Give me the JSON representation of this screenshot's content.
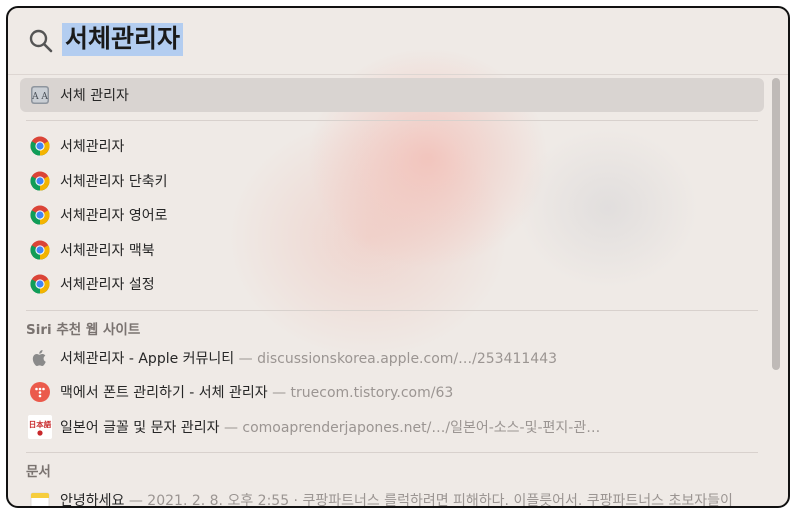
{
  "search": {
    "query": "서체관리자"
  },
  "top_hit": {
    "label": "서체 관리자",
    "icon": "font-book-icon"
  },
  "chrome_items": [
    {
      "label": "서체관리자",
      "icon": "chrome-icon"
    },
    {
      "label": "서체관리자 단축키",
      "icon": "chrome-icon"
    },
    {
      "label": "서체관리자 영어로",
      "icon": "chrome-icon"
    },
    {
      "label": "서체관리자 맥북",
      "icon": "chrome-icon"
    },
    {
      "label": "서체관리자 설정",
      "icon": "chrome-icon"
    }
  ],
  "siri_section": {
    "title": "Siri 추천 웹 사이트",
    "items": [
      {
        "label": "서체관리자 - Apple 커뮤니티",
        "source": "— discussionskorea.apple.com/…/253411443",
        "icon": "apple-logo-icon"
      },
      {
        "label": "맥에서 폰트 관리하기 - 서체 관리자",
        "source": "— truecom.tistory.com/63",
        "icon": "tistory-icon"
      },
      {
        "label": "일본어 글꼴 및 문자 관리자",
        "source": "— comoaprenderjapones.net/…/일본어-소스-및-편지-관…",
        "icon": "nihongo-site-icon",
        "badge": "日本語"
      }
    ]
  },
  "documents_section": {
    "title": "문서",
    "items": [
      {
        "label": "안녕하세요",
        "source": "— 2021. 2. 8. 오후 2:55 · 쿠팡파트너스 를럭하려면 피해하다. 이플릇어서. 쿠팡파트너스 초보자들이",
        "icon": "note-icon"
      }
    ]
  },
  "colors": {
    "background": "#efeae6",
    "selection": "#d9d4d1",
    "query_highlight": "#b3cdf0",
    "tistory_red": "#eb5a4b"
  }
}
